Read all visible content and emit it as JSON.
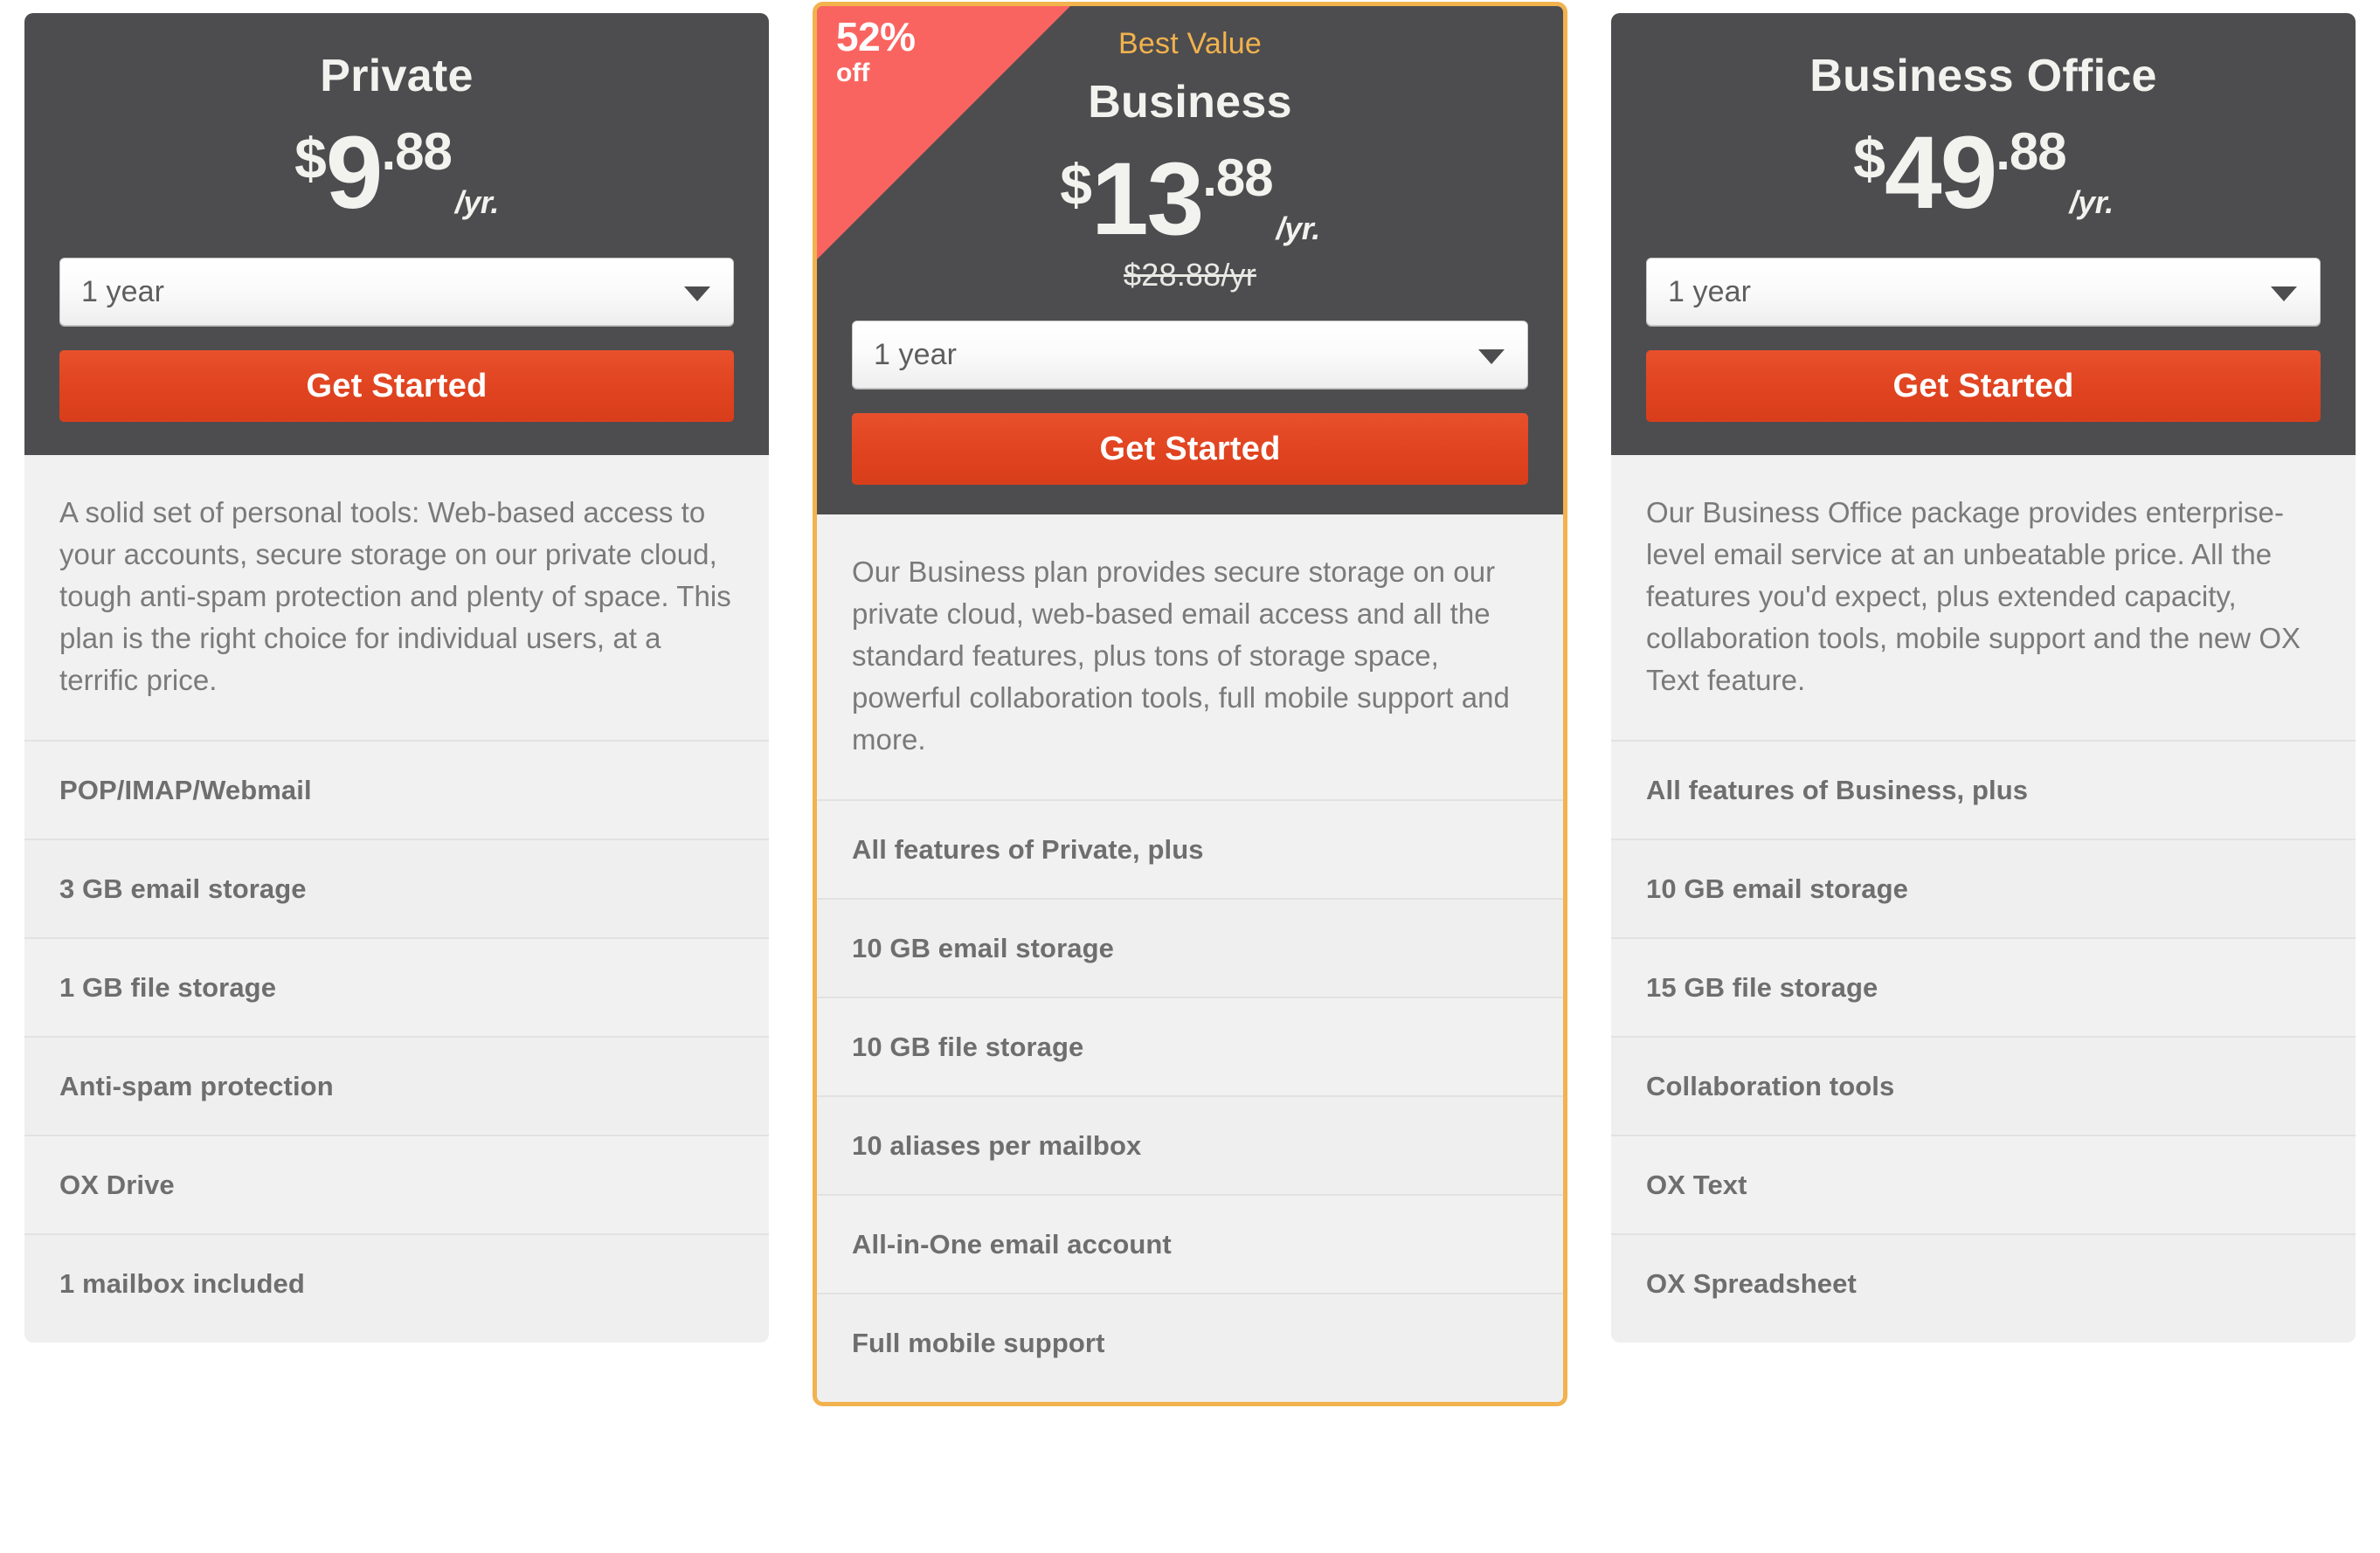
{
  "colors": {
    "header_bg": "#4d4d4f",
    "accent_orange": "#f2b24d",
    "cta_red": "#e0431f",
    "ribbon_red": "#fa6460",
    "body_bg": "#f1f1f1"
  },
  "plans": [
    {
      "name": "Private",
      "badge": null,
      "ribbon": null,
      "price": {
        "currency": "$",
        "integer": "9",
        "decimal": ".88",
        "period": "/yr."
      },
      "old_price": null,
      "term": {
        "selected": "1 year",
        "options": [
          "1 year"
        ]
      },
      "cta_label": "Get Started",
      "description": "A solid set of personal tools: Web-based access to your accounts, secure storage on our private cloud, tough anti-spam protection and plenty of space. This plan is the right choice for individual users, at a terrific price.",
      "features": [
        "POP/IMAP/Webmail",
        "3 GB email storage",
        "1 GB file storage",
        "Anti-spam protection",
        "OX Drive",
        "1 mailbox included"
      ]
    },
    {
      "name": "Business",
      "badge": "Best Value",
      "ribbon": {
        "percent": "52%",
        "word": "off"
      },
      "price": {
        "currency": "$",
        "integer": "13",
        "decimal": ".88",
        "period": "/yr."
      },
      "old_price": "$28.88/yr",
      "term": {
        "selected": "1 year",
        "options": [
          "1 year"
        ]
      },
      "cta_label": "Get Started",
      "description": "Our Business plan provides secure storage on our private cloud, web-based email access and all the standard features, plus tons of storage space, powerful collaboration tools, full mobile support and more.",
      "features": [
        "All features of Private, plus",
        "10 GB email storage",
        "10 GB file storage",
        "10 aliases per mailbox",
        "All-in-One email account",
        "Full mobile support"
      ]
    },
    {
      "name": "Business Office",
      "badge": null,
      "ribbon": null,
      "price": {
        "currency": "$",
        "integer": "49",
        "decimal": ".88",
        "period": "/yr."
      },
      "old_price": null,
      "term": {
        "selected": "1 year",
        "options": [
          "1 year"
        ]
      },
      "cta_label": "Get Started",
      "description": "Our Business Office package provides enterprise-level email service at an unbeatable price. All the features you'd expect, plus extended capacity, collaboration tools, mobile support and the new OX Text feature.",
      "features": [
        "All features of Business, plus",
        "10 GB email storage",
        "15 GB file storage",
        "Collaboration tools",
        "OX Text",
        "OX Spreadsheet"
      ]
    }
  ]
}
